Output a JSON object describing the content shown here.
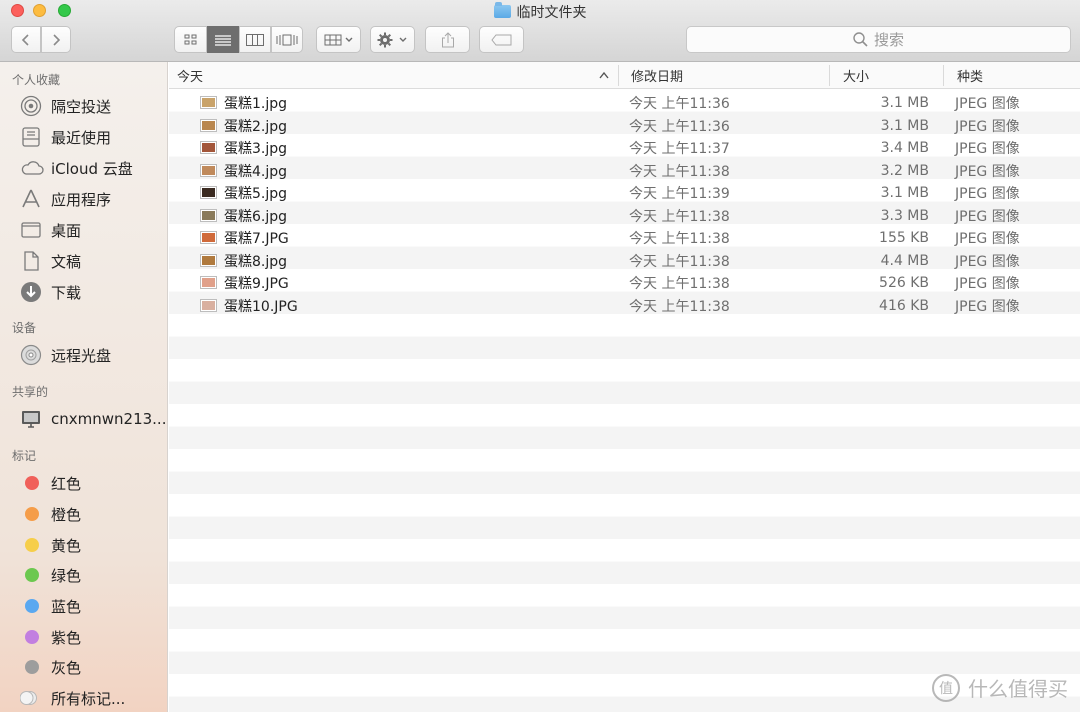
{
  "window": {
    "title": "临时文件夹"
  },
  "toolbar": {
    "search_placeholder": "搜索",
    "view_modes": [
      "icon-view",
      "list-view",
      "column-view",
      "cover-flow-view"
    ],
    "active_view": "list-view"
  },
  "sidebar": {
    "sections": [
      {
        "title": "个人收藏",
        "items": [
          {
            "label": "隔空投送",
            "icon": "airdrop-icon"
          },
          {
            "label": "最近使用",
            "icon": "recents-icon"
          },
          {
            "label": "iCloud 云盘",
            "icon": "icloud-icon"
          },
          {
            "label": "应用程序",
            "icon": "applications-icon"
          },
          {
            "label": "桌面",
            "icon": "desktop-icon"
          },
          {
            "label": "文稿",
            "icon": "documents-icon"
          },
          {
            "label": "下载",
            "icon": "downloads-icon"
          }
        ]
      },
      {
        "title": "设备",
        "items": [
          {
            "label": "远程光盘",
            "icon": "remote-disc-icon"
          }
        ]
      },
      {
        "title": "共享的",
        "items": [
          {
            "label": "cnxmnwn213...",
            "icon": "computer-icon"
          }
        ]
      },
      {
        "title": "标记",
        "items": [
          {
            "label": "红色",
            "color": "#f0605a"
          },
          {
            "label": "橙色",
            "color": "#f59d49"
          },
          {
            "label": "黄色",
            "color": "#f6ce4a"
          },
          {
            "label": "绿色",
            "color": "#6cc84f"
          },
          {
            "label": "蓝色",
            "color": "#5aa8f0"
          },
          {
            "label": "紫色",
            "color": "#c27fe0"
          },
          {
            "label": "灰色",
            "color": "#9d9d9d"
          },
          {
            "label": "所有标记...",
            "icon": "all-tags-icon"
          }
        ]
      }
    ]
  },
  "list": {
    "columns": [
      "今天",
      "修改日期",
      "大小",
      "种类"
    ],
    "rows": [
      {
        "name": "蛋糕1.jpg",
        "date": "今天 上午11:36",
        "size": "3.1 MB",
        "kind": "JPEG 图像",
        "thumb_color": "#c9a36a"
      },
      {
        "name": "蛋糕2.jpg",
        "date": "今天 上午11:36",
        "size": "3.1 MB",
        "kind": "JPEG 图像",
        "thumb_color": "#b9874f"
      },
      {
        "name": "蛋糕3.jpg",
        "date": "今天 上午11:37",
        "size": "3.4 MB",
        "kind": "JPEG 图像",
        "thumb_color": "#a3563a"
      },
      {
        "name": "蛋糕4.jpg",
        "date": "今天 上午11:38",
        "size": "3.2 MB",
        "kind": "JPEG 图像",
        "thumb_color": "#c08a5c"
      },
      {
        "name": "蛋糕5.jpg",
        "date": "今天 上午11:39",
        "size": "3.1 MB",
        "kind": "JPEG 图像",
        "thumb_color": "#3a2a20"
      },
      {
        "name": "蛋糕6.jpg",
        "date": "今天 上午11:38",
        "size": "3.3 MB",
        "kind": "JPEG 图像",
        "thumb_color": "#8a7a5a"
      },
      {
        "name": "蛋糕7.JPG",
        "date": "今天 上午11:38",
        "size": "155 KB",
        "kind": "JPEG 图像",
        "thumb_color": "#d06a3a"
      },
      {
        "name": "蛋糕8.jpg",
        "date": "今天 上午11:38",
        "size": "4.4 MB",
        "kind": "JPEG 图像",
        "thumb_color": "#b07a3e"
      },
      {
        "name": "蛋糕9.JPG",
        "date": "今天 上午11:38",
        "size": "526 KB",
        "kind": "JPEG 图像",
        "thumb_color": "#e0a08a"
      },
      {
        "name": "蛋糕10.JPG",
        "date": "今天 上午11:38",
        "size": "416 KB",
        "kind": "JPEG 图像",
        "thumb_color": "#d9b0a0"
      }
    ]
  },
  "watermark": {
    "text": "什么值得买",
    "icon_glyph": "值"
  }
}
